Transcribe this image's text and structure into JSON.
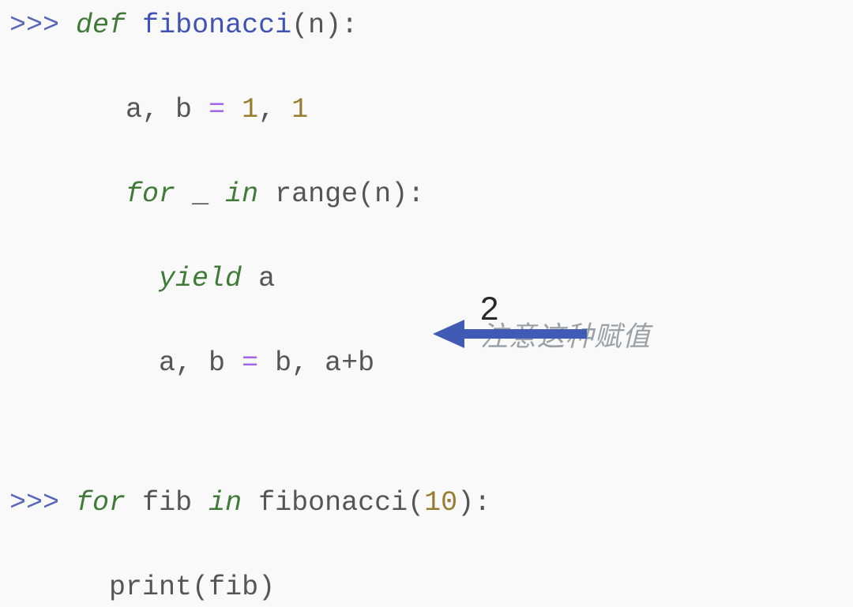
{
  "code": {
    "prompt": ">>>",
    "l1": {
      "def": "def",
      "name": "fibonacci",
      "paren_open": "(",
      "arg": "n",
      "paren_close_colon": "):"
    },
    "l2": {
      "vars": "a, b",
      "eq": "=",
      "v1": "1",
      "comma": ",",
      "v2": "1"
    },
    "l3": {
      "for": "for",
      "var": "_",
      "in": "in",
      "range": "range",
      "po": "(",
      "arg": "n",
      "pc_colon": "):"
    },
    "l4": {
      "yield": "yield",
      "var": "a"
    },
    "l5": {
      "lhs": "a, b",
      "eq": "=",
      "rhs": "b, a+b"
    },
    "l6": {
      "for": "for",
      "var": "fib",
      "in": "in",
      "fn": "fibonacci",
      "po": "(",
      "arg": "10",
      "pc_colon": "):"
    },
    "l7": {
      "print": "print",
      "po": "(",
      "arg": "fib",
      "pc": ")"
    }
  },
  "annotation": {
    "number": "2",
    "note": "注意这种赋值",
    "arrow_color": "#3f5bb5"
  }
}
